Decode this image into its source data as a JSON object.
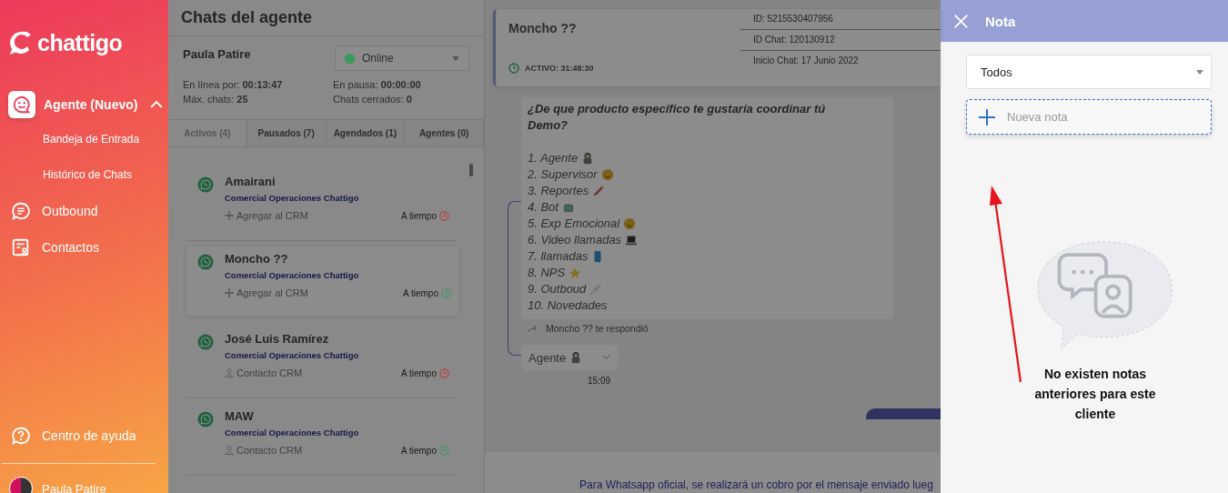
{
  "sidebar": {
    "logo": "chattigo",
    "items": [
      {
        "label": "Agente (Nuevo)",
        "expanded": true,
        "children": [
          {
            "label": "Bandeja de Entrada"
          },
          {
            "label": "Histórico de Chats"
          }
        ]
      },
      {
        "label": "Outbound"
      },
      {
        "label": "Contactos"
      }
    ],
    "help": "Centro de ayuda",
    "user": "Paula Patire"
  },
  "agent_panel": {
    "title": "Chats del agente",
    "agent_name": "Paula Patire",
    "status": {
      "label": "Online",
      "color": "#3a9a5c"
    },
    "stats": [
      {
        "label": "En línea por:",
        "value": "00:13:47"
      },
      {
        "label": "En pausa:",
        "value": "00:00:00"
      },
      {
        "label": "Máx. chats:",
        "value": "25"
      },
      {
        "label": "Chats cerrados:",
        "value": "0"
      }
    ],
    "tabs": [
      {
        "label": "Activos (4)",
        "selected": true
      },
      {
        "label": "Pausados (7)",
        "selected": false
      },
      {
        "label": "Agendados (1)",
        "selected": false
      },
      {
        "label": "Agentes (0)",
        "selected": false
      }
    ],
    "chats": [
      {
        "name": "Amairani",
        "team": "Comercial Operaciones Chattigo",
        "action": "Agregar al CRM",
        "kind": "add",
        "timing": "A tiempo",
        "color": "#c23b3b",
        "selected": false
      },
      {
        "name": "Moncho ??",
        "team": "Comercial Operaciones Chattigo",
        "action": "Agregar al CRM",
        "kind": "add",
        "timing": "A tiempo",
        "color": "#3a9a5c",
        "selected": true
      },
      {
        "name": "José Luis Ramírez",
        "team": "Comercial Operaciones Chattigo",
        "action": "Contacto CRM",
        "kind": "contact",
        "timing": "A tiempo",
        "color": "#c23b3b",
        "selected": false
      },
      {
        "name": "MAW",
        "team": "Comercial Operaciones Chattigo",
        "action": "Contacto CRM",
        "kind": "contact",
        "timing": "A tiempo",
        "color": "#3a9a5c",
        "selected": false
      }
    ]
  },
  "chat": {
    "name": "Moncho ??",
    "active": "ACTIVO: 31:48:30",
    "details": [
      "ID: 5215530407956",
      "ID Chat: 120130912",
      "Inicio Chat: 17 Junio 2022"
    ],
    "question": "¿De que producto específico te gustaría coordinar tú Demo?",
    "options": [
      "1. Agente",
      "2. Supervisor",
      "3. Reportes",
      "4. Bot",
      "5. Exp Emocional",
      "6. Video llamadas",
      "7. llamadas",
      "8. NPS",
      "9. Outboud",
      "10. Novedades"
    ],
    "reply_note": "Moncho ?? te respondió",
    "reply": "Agente",
    "time": "15:09",
    "notice": "Para Whatsapp oficial, se realizará un cobro por el mensaje enviado lueg"
  },
  "note_panel": {
    "title": "Nota",
    "filter": "Todos",
    "new_note": "Nueva nota",
    "empty_message": "No existen notas anteriores para este cliente"
  }
}
